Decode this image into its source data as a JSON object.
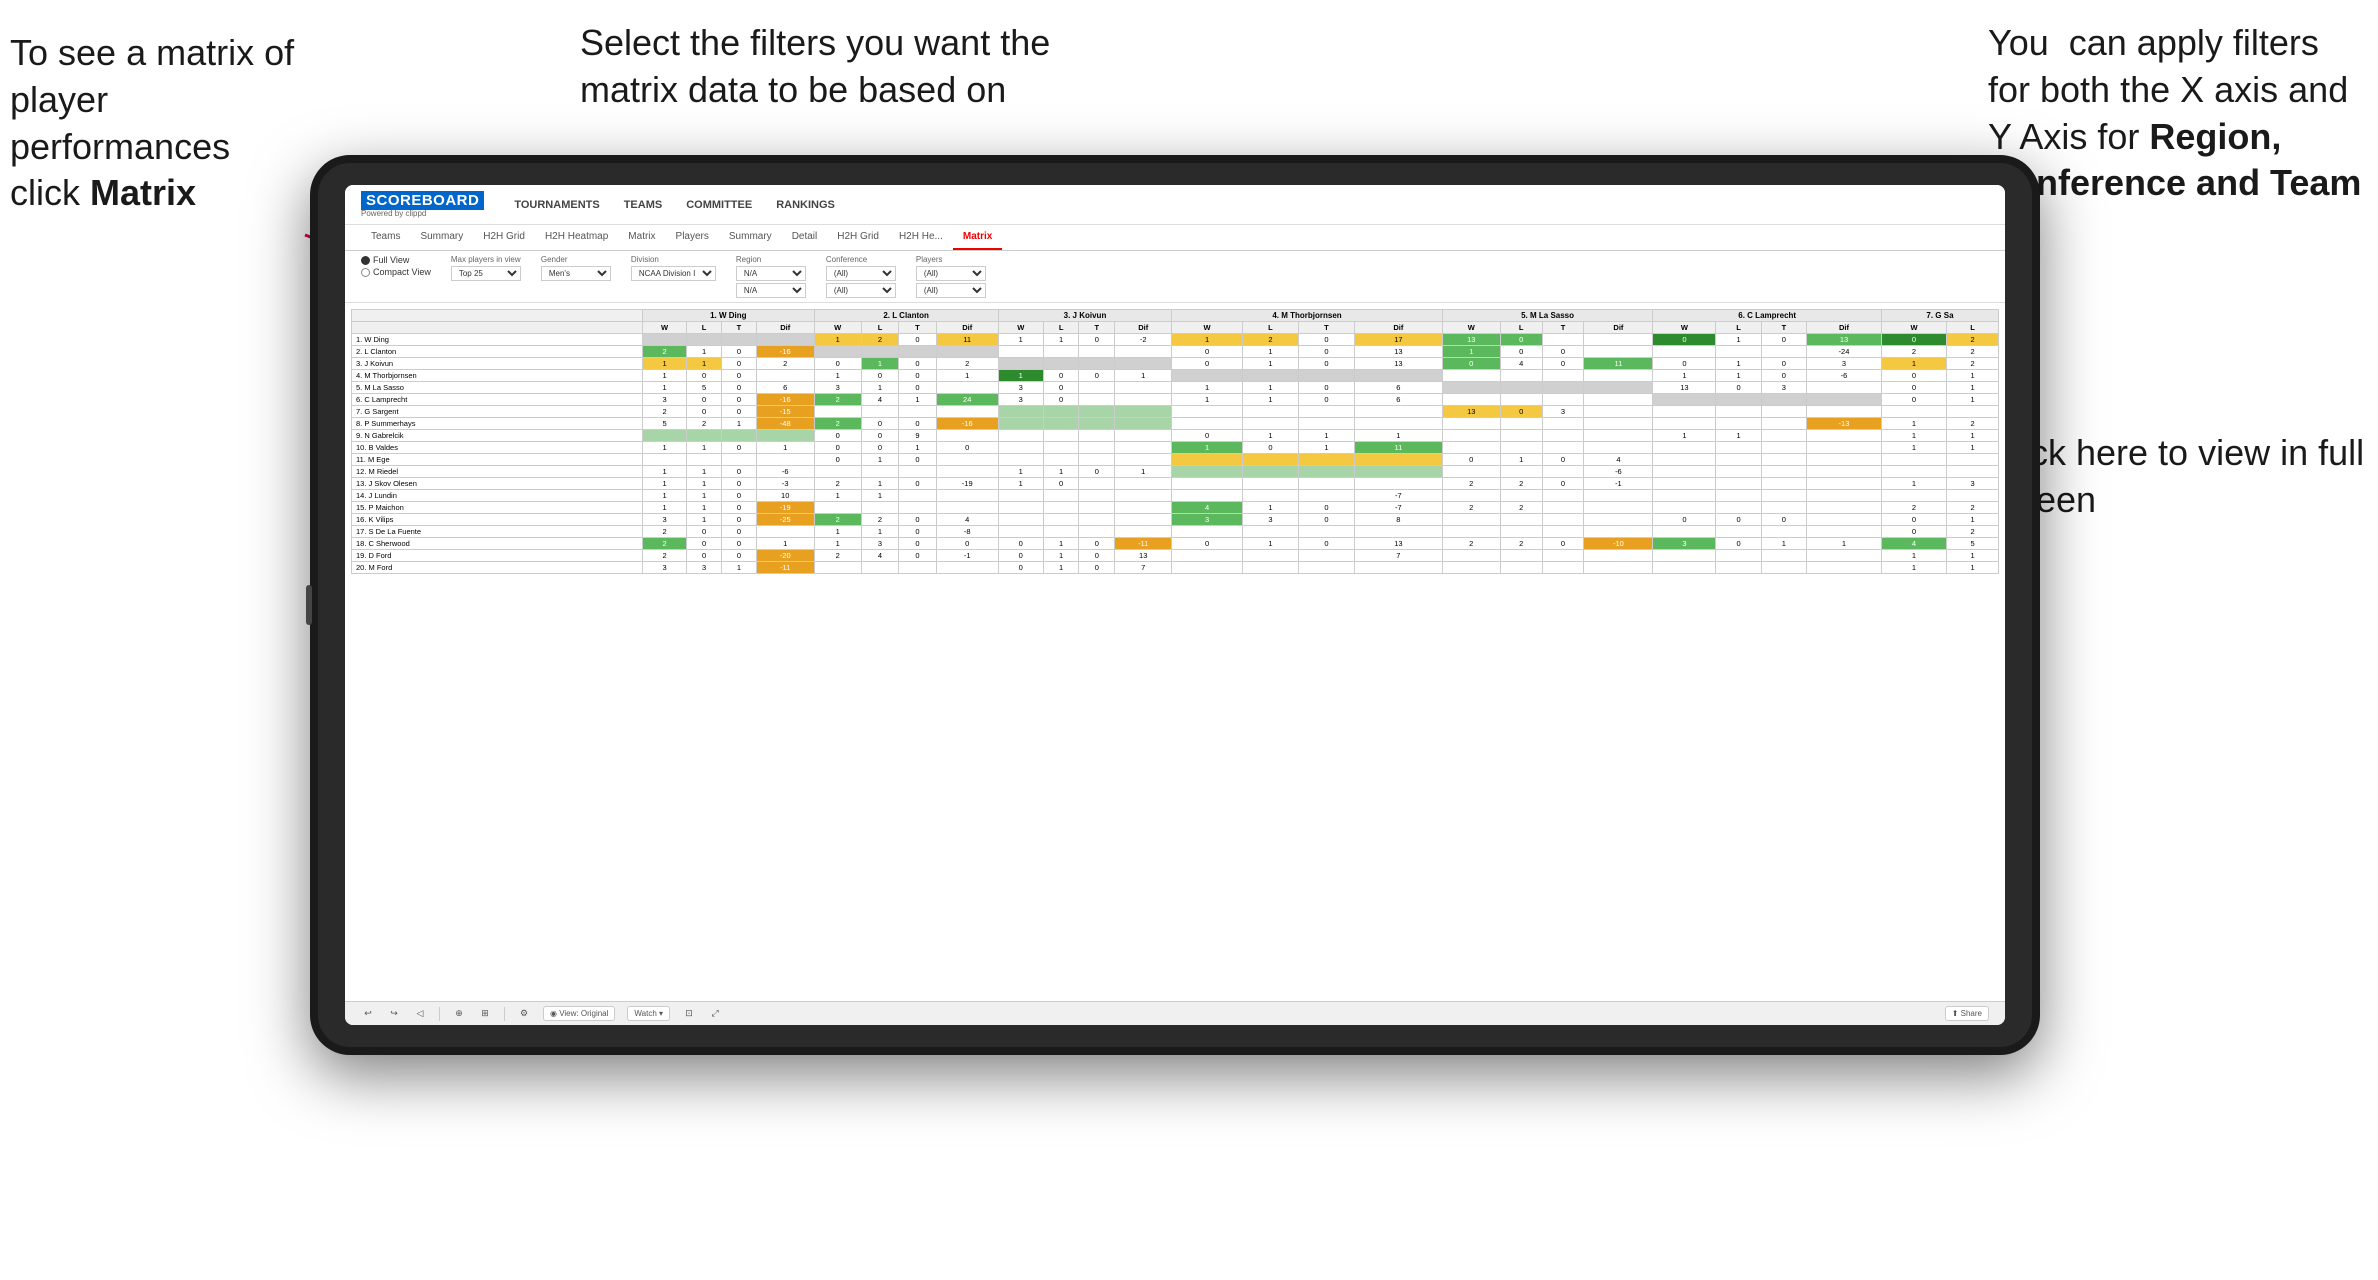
{
  "annotations": {
    "left": {
      "line1": "To see a matrix of",
      "line2": "player performances",
      "line3_pre": "click ",
      "line3_bold": "Matrix"
    },
    "center": {
      "text": "Select the filters you want the matrix data to be based on"
    },
    "right_top": {
      "line1": "You  can apply",
      "line2": "filters for both",
      "line3": "the X axis and Y",
      "line4_pre": "Axis for ",
      "line4_bold": "Region,",
      "line5_bold": "Conference and",
      "line6_bold": "Team"
    },
    "right_bottom": {
      "line1": "Click here to view",
      "line2": "in full screen"
    }
  },
  "app": {
    "logo": "SCOREBOARD",
    "logo_sub": "Powered by clippd",
    "nav_items": [
      "TOURNAMENTS",
      "TEAMS",
      "COMMITTEE",
      "RANKINGS"
    ],
    "sub_nav": [
      "Teams",
      "Summary",
      "H2H Grid",
      "H2H Heatmap",
      "Matrix",
      "Players",
      "Summary",
      "Detail",
      "H2H Grid",
      "H2H He...",
      "Matrix"
    ],
    "active_tab": "Matrix"
  },
  "filters": {
    "view_full": "Full View",
    "view_compact": "Compact View",
    "max_players_label": "Max players in view",
    "max_players_val": "Top 25",
    "gender_label": "Gender",
    "gender_val": "Men's",
    "division_label": "Division",
    "division_val": "NCAA Division I",
    "region_label": "Region",
    "region_val1": "N/A",
    "region_val2": "N/A",
    "conference_label": "Conference",
    "conf_val1": "(All)",
    "conf_val2": "(All)",
    "players_label": "Players",
    "players_val1": "(All)",
    "players_val2": "(All)"
  },
  "matrix": {
    "col_headers": [
      "1. W Ding",
      "2. L Clanton",
      "3. J Koivun",
      "4. M Thorbjornsen",
      "5. M La Sasso",
      "6. C Lamprecht",
      "7. G Sa"
    ],
    "sub_headers": [
      "W",
      "L",
      "T",
      "Dif"
    ],
    "rows": [
      {
        "name": "1. W Ding",
        "cells": "diagonal"
      },
      {
        "name": "2. L Clanton"
      },
      {
        "name": "3. J Koivun"
      },
      {
        "name": "4. M Thorbjornsen"
      },
      {
        "name": "5. M La Sasso"
      },
      {
        "name": "6. C Lamprecht"
      },
      {
        "name": "7. G Sargent"
      },
      {
        "name": "8. P Summerhays"
      },
      {
        "name": "9. N Gabrelcik"
      },
      {
        "name": "10. B Valdes"
      },
      {
        "name": "11. M Ege"
      },
      {
        "name": "12. M Riedel"
      },
      {
        "name": "13. J Skov Olesen"
      },
      {
        "name": "14. J Lundin"
      },
      {
        "name": "15. P Maichon"
      },
      {
        "name": "16. K Vilips"
      },
      {
        "name": "17. S De La Fuente"
      },
      {
        "name": "18. C Sherwood"
      },
      {
        "name": "19. D Ford"
      },
      {
        "name": "20. M Ford"
      }
    ]
  },
  "toolbar": {
    "view_original": "View: Original",
    "watch": "Watch",
    "share": "Share"
  }
}
